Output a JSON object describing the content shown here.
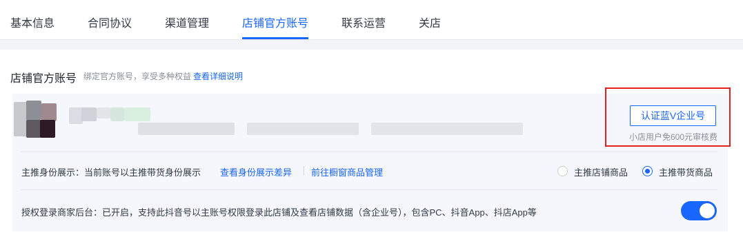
{
  "tabs": [
    {
      "label": "基本信息",
      "active": false
    },
    {
      "label": "合同协议",
      "active": false
    },
    {
      "label": "渠道管理",
      "active": false
    },
    {
      "label": "店铺官方账号",
      "active": true
    },
    {
      "label": "联系运营",
      "active": false
    },
    {
      "label": "关店",
      "active": false
    }
  ],
  "section": {
    "title": "店铺官方账号",
    "desc": "绑定官方账号，享受多种权益",
    "link": "查看详细说明"
  },
  "account": {
    "verify_button": "认证蓝V企业号",
    "fee_note": "小店用户免600元审核费"
  },
  "identity": {
    "label": "主推身份展示：当前账号以主推带货身份展示",
    "link_diff": "查看身份展示差异",
    "link_manage": "前往橱窗商品管理",
    "options": [
      {
        "label": "主推店铺商品",
        "selected": false
      },
      {
        "label": "主推带货商品",
        "selected": true
      }
    ]
  },
  "auth": {
    "label": "授权登录商家后台：已开启，支持此抖音号以主账号权限登录此店铺及查看店铺数据（含企业号），包含PC、抖音App、抖店App等",
    "enabled": true
  },
  "colors": {
    "accent": "#1966ff",
    "highlight": "#e02020"
  }
}
